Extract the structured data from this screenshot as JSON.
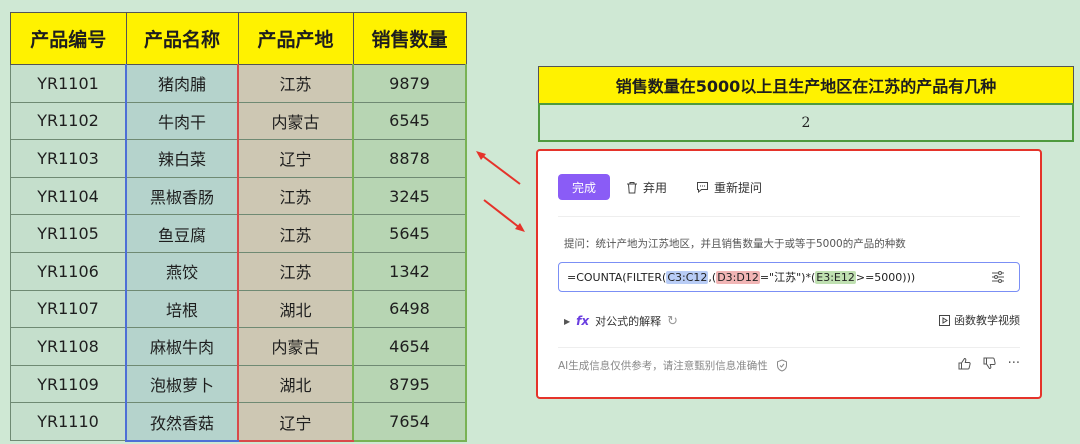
{
  "table": {
    "headers": [
      "产品编号",
      "产品名称",
      "产品产地",
      "销售数量"
    ],
    "rows": [
      [
        "YR1101",
        "猪肉脯",
        "江苏",
        "9879"
      ],
      [
        "YR1102",
        "牛肉干",
        "内蒙古",
        "6545"
      ],
      [
        "YR1103",
        "辣白菜",
        "辽宁",
        "8878"
      ],
      [
        "YR1104",
        "黑椒香肠",
        "江苏",
        "3245"
      ],
      [
        "YR1105",
        "鱼豆腐",
        "江苏",
        "5645"
      ],
      [
        "YR1106",
        "燕饺",
        "江苏",
        "1342"
      ],
      [
        "YR1107",
        "培根",
        "湖北",
        "6498"
      ],
      [
        "YR1108",
        "麻椒牛肉",
        "内蒙古",
        "4654"
      ],
      [
        "YR1109",
        "泡椒萝卜",
        "湖北",
        "8795"
      ],
      [
        "YR1110",
        "孜然香菇",
        "辽宁",
        "7654"
      ]
    ]
  },
  "question": "销售数量在5000以上且生产地区在江苏的产品有几种",
  "answer": "2",
  "ai_panel": {
    "done_label": "完成",
    "discard_label": "弃用",
    "reask_label": "重新提问",
    "prompt_text": "提问：统计产地为江苏地区，并且销售数量大于或等于5000的产品的种数",
    "formula": {
      "p1": "=COUNTA(FILTER(",
      "ref1": "C3:C12",
      "p2": ",(",
      "ref2": "D3:D12",
      "p3": "=\"江苏\")*(",
      "ref3": "E3:E12",
      "p4": ">=5000)))"
    },
    "explain_label": "对公式的解释",
    "video_label": "函数教学视频",
    "disclaimer": "AI生成信息仅供参考，请注意甄别信息准确性",
    "more_label": "···"
  },
  "colors": {
    "accent_purple": "#8a5cf6",
    "header_yellow": "#fff200",
    "panel_border_red": "#e5332a"
  }
}
